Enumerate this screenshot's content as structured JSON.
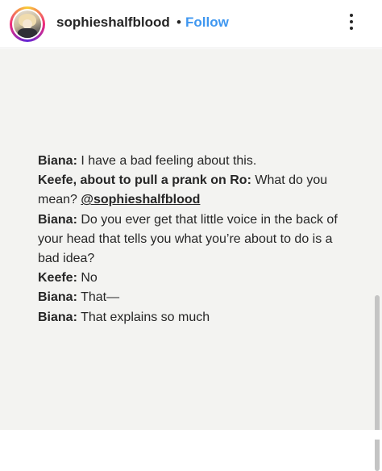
{
  "header": {
    "username": "sophieshalfblood",
    "separator": "•",
    "follow_label": "Follow",
    "avatar_icon": "profile-avatar",
    "more_icon": "more-vertical-icon"
  },
  "post": {
    "background_color": "#f3f3f1",
    "lines": [
      {
        "speaker": "Biana:",
        "text": "I have a bad feeling about this."
      },
      {
        "speaker": "Keefe, about to pull a prank on Ro:",
        "text": "What do you mean?",
        "mention": "@sophieshalfblood"
      },
      {
        "speaker": "Biana:",
        "text": "Do you ever get that little voice in the back of your head that tells you what you’re about to do is a bad idea?"
      },
      {
        "speaker": "Keefe:",
        "text": "No"
      },
      {
        "speaker": "Biana:",
        "text": "That—"
      },
      {
        "speaker": "Biana:",
        "text": "That explains so much"
      }
    ]
  },
  "colors": {
    "follow": "#3f97f0",
    "text": "#262626"
  }
}
